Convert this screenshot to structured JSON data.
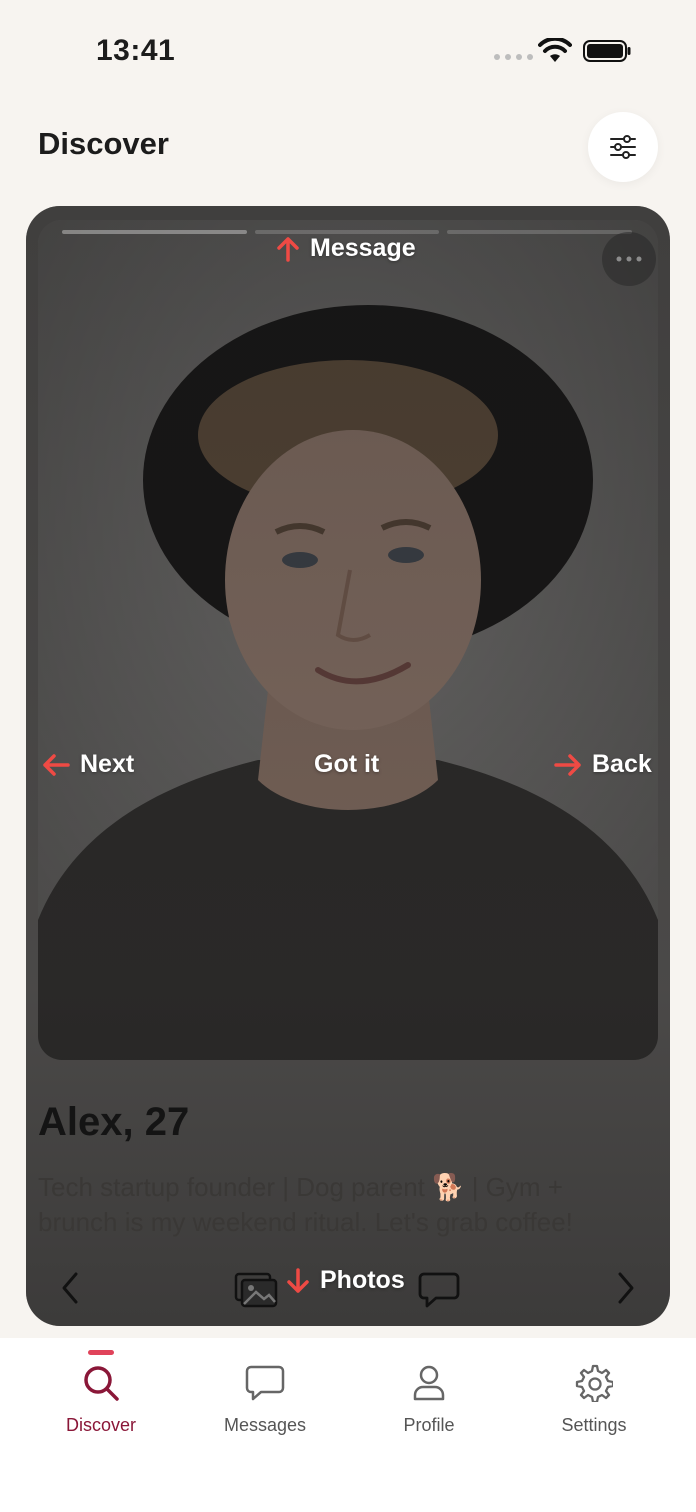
{
  "status": {
    "time": "13:41"
  },
  "header": {
    "title": "Discover"
  },
  "profile": {
    "name_age": "Alex, 27",
    "bio": "Tech startup founder | Dog parent 🐕 | Gym + brunch is my weekend ritual. Let's grab coffee!"
  },
  "gestures": {
    "up": "Message",
    "left": "Next",
    "center": "Got it",
    "right": "Back",
    "down": "Photos"
  },
  "tabs": [
    {
      "label": "Discover",
      "icon": "search-icon",
      "active": true
    },
    {
      "label": "Messages",
      "icon": "chat-bubble-icon",
      "active": false
    },
    {
      "label": "Profile",
      "icon": "person-icon",
      "active": false
    },
    {
      "label": "Settings",
      "icon": "gear-icon",
      "active": false
    }
  ],
  "colors": {
    "accent": "#e0435a",
    "active_tab": "#8a1738",
    "hint_arrow": "#ef4a44"
  }
}
